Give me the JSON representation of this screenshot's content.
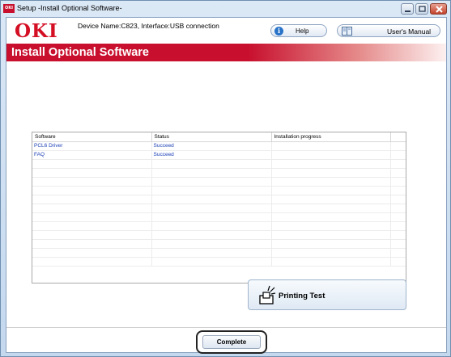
{
  "window": {
    "title": "Setup -Install Optional Software-",
    "icon_text": "OKI"
  },
  "header": {
    "logo_text": "OKI",
    "device_info": "Device Name:C823, Interface:USB connection",
    "help_label": "Help",
    "manual_label": "User's Manual"
  },
  "banner": {
    "title": "Install Optional Software"
  },
  "table": {
    "headers": [
      "Software",
      "Status",
      "Installation progress"
    ],
    "rows": [
      {
        "software": "PCL6 Driver",
        "status": "Succeed",
        "progress": ""
      },
      {
        "software": "FAQ",
        "status": "Succeed",
        "progress": ""
      }
    ]
  },
  "actions": {
    "printing_test_label": "Printing Test",
    "complete_label": "Complete"
  },
  "colors": {
    "brand_red": "#c8102e",
    "link_blue": "#1a3fb5"
  }
}
